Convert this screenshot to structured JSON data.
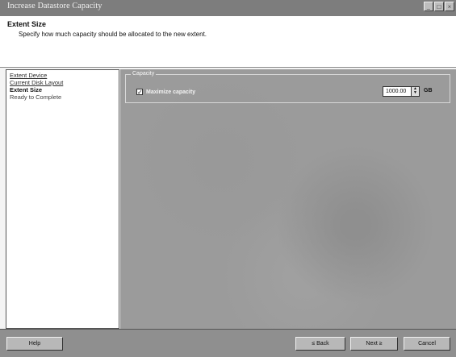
{
  "window": {
    "title": "Increase Datastore Capacity",
    "controls": [
      "_",
      "□",
      "×"
    ]
  },
  "header": {
    "step_title": "Extent Size",
    "step_description": "Specify how much capacity should be allocated to the new extent."
  },
  "nav": {
    "items": [
      {
        "label": "Extent Device",
        "state": "link"
      },
      {
        "label": "Current Disk Layout",
        "state": "link"
      },
      {
        "label": "Extent Size",
        "state": "current"
      },
      {
        "label": "Ready to Complete",
        "state": "plain"
      }
    ]
  },
  "capacity": {
    "group_label": "Capacity",
    "checkbox_label": "Maximize capacity",
    "checked": true,
    "size_value": "1000.00",
    "unit": "GB"
  },
  "footer": {
    "help_label": "Help",
    "back_label": "≤ Back",
    "next_label": "Next ≥",
    "cancel_label": "Cancel"
  }
}
